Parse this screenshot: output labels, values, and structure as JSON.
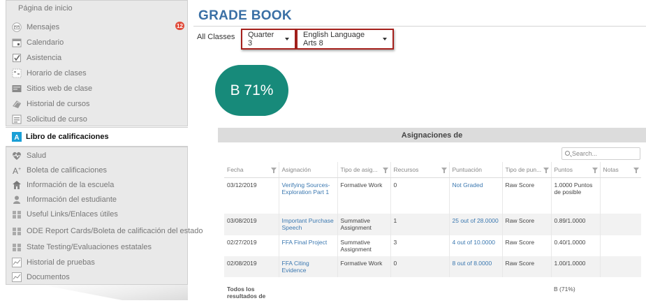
{
  "sidebar": {
    "home": "Página de inicio",
    "badge": "12",
    "top_items": [
      {
        "label": "Mensajes",
        "icon": "envelope-icon"
      },
      {
        "label": "Calendario",
        "icon": "calendar-icon"
      },
      {
        "label": "Asistencia",
        "icon": "checkbox-icon"
      },
      {
        "label": "Horario de clases",
        "icon": "schedule-icon"
      },
      {
        "label": "Sitios web de clase",
        "icon": "website-icon"
      },
      {
        "label": "Historial de cursos",
        "icon": "course-history-icon"
      },
      {
        "label": "Solicitud de curso",
        "icon": "course-request-icon"
      }
    ],
    "active": {
      "label": "Libro de calificaciones",
      "icon": "gradebook-icon"
    },
    "bottom_items": [
      {
        "label": "Salud",
        "icon": "health-icon"
      },
      {
        "label": "Boleta de calificaciones",
        "icon": "report-card-icon"
      },
      {
        "label": "Información de la escuela",
        "icon": "school-icon"
      },
      {
        "label": "Información del estudiante",
        "icon": "student-icon"
      },
      {
        "label": "Useful Links/Enlaces útiles",
        "icon": "people-icon"
      },
      {
        "label": "ODE Report Cards/Boleta de calificación del estado",
        "icon": "people-icon"
      },
      {
        "label": "State Testing/Evaluaciones estatales",
        "icon": "people-icon"
      },
      {
        "label": "Historial de pruebas",
        "icon": "chart-icon"
      },
      {
        "label": "Documentos",
        "icon": "chart-icon"
      }
    ]
  },
  "main": {
    "title": "GRADE BOOK",
    "tab_all": "All Classes",
    "quarter": "Quarter 3",
    "course": "English Language Arts 8",
    "grade": "B 71%"
  },
  "table": {
    "heading": "Asignaciones de",
    "search_placeholder": "Search...",
    "columns": [
      "Fecha",
      "Asignación",
      "Tipo de asig...",
      "Recursos",
      "Puntuación",
      "Tipo de pun...",
      "Puntos",
      "Notas"
    ],
    "rows": [
      {
        "fecha": "03/12/2019",
        "asignacion": "Verifying Sources-Exploration Part 1",
        "tipo": "Formative Work",
        "recursos": "0",
        "puntuacion": "Not Graded",
        "tipo_pun": "Raw Score",
        "puntos": "1.0000 Puntos de posible",
        "notas": ""
      },
      {
        "fecha": "03/08/2019",
        "asignacion": "Important Purchase Speech",
        "tipo": "Summative Assignment",
        "recursos": "1",
        "puntuacion": "25 out of 28.0000",
        "tipo_pun": "Raw Score",
        "puntos": "0.89/1.0000",
        "notas": ""
      },
      {
        "fecha": "02/27/2019",
        "asignacion": "FFA Final Project",
        "tipo": "Summative Assignment",
        "recursos": "3",
        "puntuacion": "4 out of 10.0000",
        "tipo_pun": "Raw Score",
        "puntos": "0.40/1.0000",
        "notas": ""
      },
      {
        "fecha": "02/08/2019",
        "asignacion": "FFA Citing Evidence",
        "tipo": "Formative Work",
        "recursos": "0",
        "puntuacion": "8 out of 8.0000",
        "tipo_pun": "Raw Score",
        "puntos": "1.00/1.0000",
        "notas": ""
      }
    ],
    "total_label": "Todos los resultados de",
    "total_value": "B (71%)"
  }
}
